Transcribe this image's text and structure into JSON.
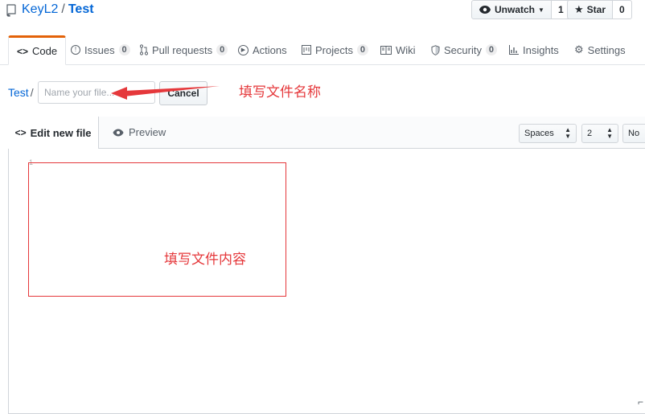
{
  "repo": {
    "owner": "KeyL2",
    "separator": "/",
    "name": "Test"
  },
  "actions": {
    "unwatch_label": "Unwatch",
    "watch_count": "1",
    "star_label": "Star",
    "star_count": "0"
  },
  "nav": {
    "tabs": [
      {
        "label": "Code"
      },
      {
        "label": "Issues",
        "count": "0"
      },
      {
        "label": "Pull requests",
        "count": "0"
      },
      {
        "label": "Actions"
      },
      {
        "label": "Projects",
        "count": "0"
      },
      {
        "label": "Wiki"
      },
      {
        "label": "Security",
        "count": "0"
      },
      {
        "label": "Insights"
      },
      {
        "label": "Settings"
      }
    ]
  },
  "file": {
    "breadcrumb": "Test",
    "slash": "/",
    "name_placeholder": "Name your file...",
    "cancel_label": "Cancel"
  },
  "editor": {
    "edit_tab": "Edit new file",
    "preview_tab": "Preview",
    "indent_mode": "Spaces",
    "indent_size": "2",
    "wrap_mode_partial": "No",
    "line_number": "1"
  },
  "annotations": {
    "filename_note": "填写文件名称",
    "content_note": "填写文件内容"
  },
  "colors": {
    "link": "#0366d6",
    "annotation": "#e5383b",
    "tab_accent": "#e36209"
  }
}
